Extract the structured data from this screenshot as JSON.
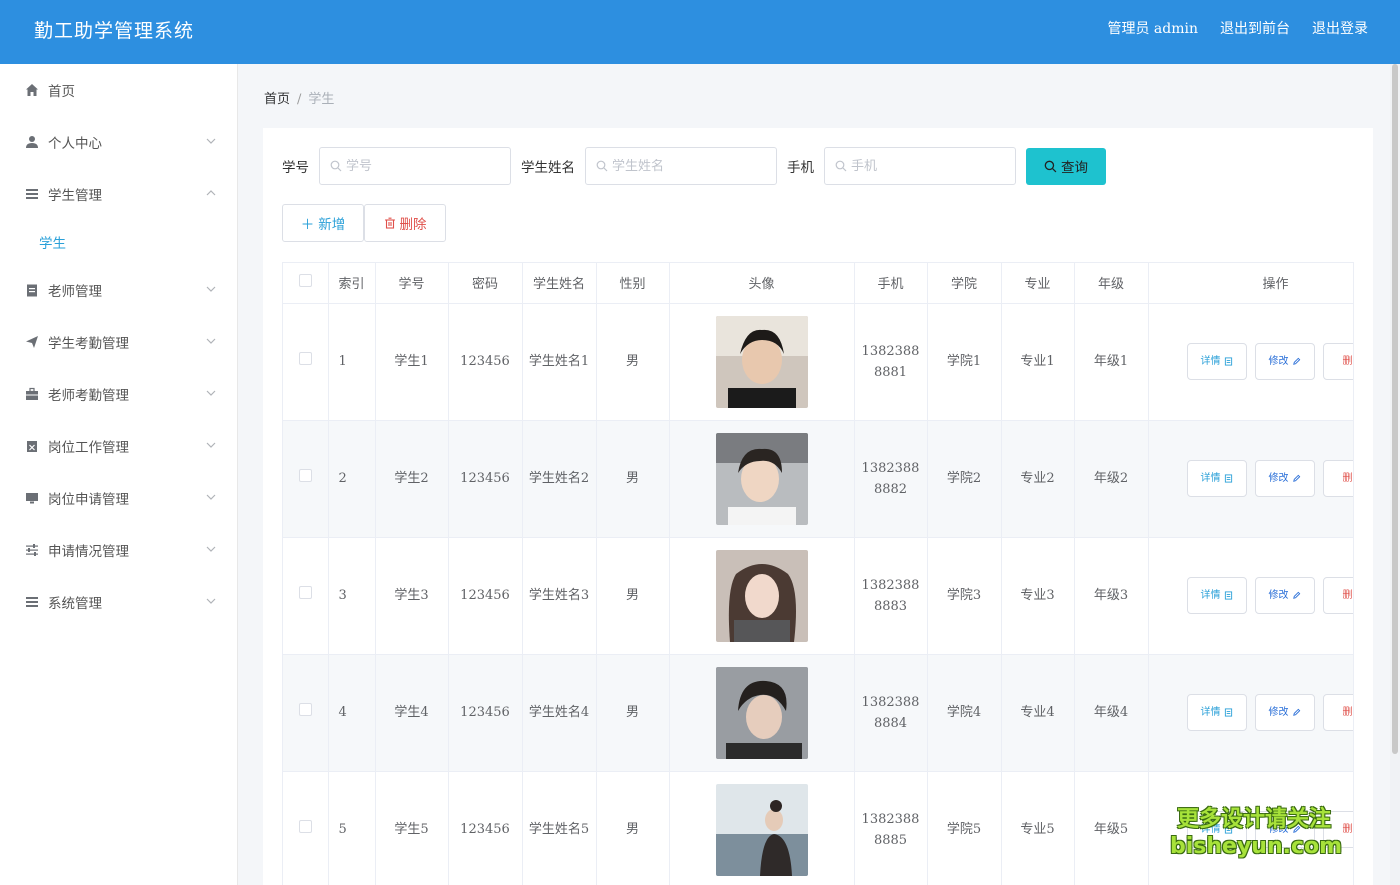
{
  "header": {
    "title": "勤工助学管理系统",
    "nav": [
      "管理员 admin",
      "退出到前台",
      "退出登录"
    ],
    "color": "#2d8fe0"
  },
  "sidebar": {
    "items": [
      {
        "label": "首页",
        "icon": "home-icon"
      },
      {
        "label": "个人中心",
        "icon": "user-icon"
      },
      {
        "label": "学生管理",
        "icon": "list-icon",
        "expanded": true,
        "children": [
          "学生"
        ]
      },
      {
        "label": "老师管理",
        "icon": "clipboard-icon"
      },
      {
        "label": "学生考勤管理",
        "icon": "send-icon"
      },
      {
        "label": "老师考勤管理",
        "icon": "briefcase-icon"
      },
      {
        "label": "岗位工作管理",
        "icon": "calendar-icon"
      },
      {
        "label": "岗位申请管理",
        "icon": "monitor-icon"
      },
      {
        "label": "申请情况管理",
        "icon": "sliders-icon"
      },
      {
        "label": "系统管理",
        "icon": "list-icon"
      }
    ],
    "active_color": "#2aa0d8"
  },
  "breadcrumb": {
    "home": "首页",
    "separator": "/",
    "current": "学生"
  },
  "search": {
    "student_no_label": "学号",
    "student_no_placeholder": "学号",
    "name_label": "学生姓名",
    "name_placeholder": "学生姓名",
    "phone_label": "手机",
    "phone_placeholder": "手机",
    "query_button": "查询"
  },
  "toolbar": {
    "add_label": "新增",
    "delete_label": "删除"
  },
  "table": {
    "columns": [
      "索引",
      "学号",
      "密码",
      "学生姓名",
      "性别",
      "头像",
      "手机",
      "学院",
      "专业",
      "年级",
      "操作"
    ],
    "rows": [
      {
        "index": "1",
        "student_no": "学生1",
        "password": "123456",
        "name": "学生姓名1",
        "gender": "男",
        "phone": "13823888881",
        "college": "学院1",
        "major": "专业1",
        "grade": "年级1"
      },
      {
        "index": "2",
        "student_no": "学生2",
        "password": "123456",
        "name": "学生姓名2",
        "gender": "男",
        "phone": "13823888882",
        "college": "学院2",
        "major": "专业2",
        "grade": "年级2"
      },
      {
        "index": "3",
        "student_no": "学生3",
        "password": "123456",
        "name": "学生姓名3",
        "gender": "男",
        "phone": "13823888883",
        "college": "学院3",
        "major": "专业3",
        "grade": "年级3"
      },
      {
        "index": "4",
        "student_no": "学生4",
        "password": "123456",
        "name": "学生姓名4",
        "gender": "男",
        "phone": "13823888884",
        "college": "学院4",
        "major": "专业4",
        "grade": "年级4"
      },
      {
        "index": "5",
        "student_no": "学生5",
        "password": "123456",
        "name": "学生姓名5",
        "gender": "男",
        "phone": "13823888885",
        "college": "学院5",
        "major": "专业5",
        "grade": "年级5"
      }
    ],
    "row_actions": {
      "detail": "详情",
      "edit": "修改",
      "delete": "删除"
    }
  },
  "watermark": {
    "line1": "更多设计请关注",
    "line2": "bisheyun.com"
  }
}
